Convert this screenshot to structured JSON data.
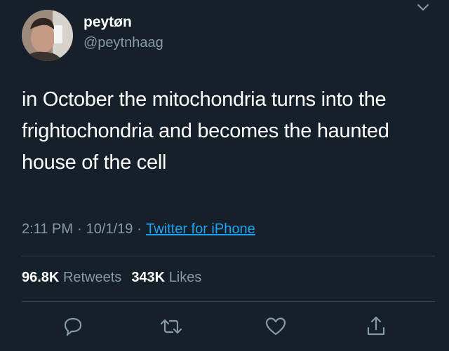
{
  "tweet": {
    "display_name": "peytøn",
    "handle": "@peytnhaag",
    "text": "in October the mitochondria turns into the frightochondria and becomes the haunted house of the cell",
    "time": "2:11 PM",
    "date": "10/1/19",
    "separator": "·",
    "source": "Twitter for iPhone"
  },
  "stats": {
    "retweets_count": "96.8K",
    "retweets_label": "Retweets",
    "likes_count": "343K",
    "likes_label": "Likes"
  },
  "icons": {
    "menu": "chevron-down-icon",
    "reply": "reply-icon",
    "retweet": "retweet-icon",
    "like": "heart-icon",
    "share": "share-icon"
  },
  "colors": {
    "background": "#15202b",
    "text": "#ffffff",
    "secondary": "#8899a6",
    "link": "#1da1f2",
    "divider": "#38444d"
  }
}
